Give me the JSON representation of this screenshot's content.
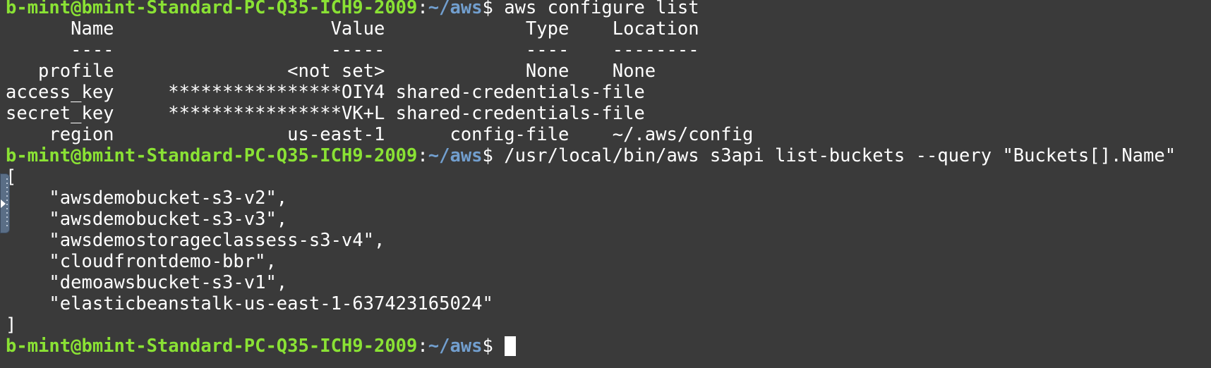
{
  "prompt": {
    "user_host": "b-mint@bmint-Standard-PC-Q35-ICH9-2009",
    "path": "~/aws",
    "sign": "$"
  },
  "commands": {
    "configure_list": "aws configure list",
    "list_buckets": "/usr/local/bin/aws s3api list-buckets --query \"Buckets[].Name\""
  },
  "configure_table": {
    "header": "      Name                    Value             Type    Location",
    "separator": "      ----                    -----             ----    --------",
    "rows": [
      "   profile                <not set>             None    None",
      "access_key     ****************OIY4 shared-credentials-file",
      "secret_key     ****************VK+L shared-credentials-file",
      "    region                us-east-1      config-file    ~/.aws/config"
    ]
  },
  "buckets_output": {
    "open_bracket": "[",
    "items": [
      "    \"awsdemobucket-s3-v2\",",
      "    \"awsdemobucket-s3-v3\",",
      "    \"awsdemostorageclassess-s3-v4\",",
      "    \"cloudfrontdemo-bbr\",",
      "    \"demoawsbucket-s3-v1\",",
      "    \"elasticbeanstalk-us-east-1-637423165024\""
    ],
    "close_bracket": "]"
  },
  "colors": {
    "background": "#3a3a3a",
    "prompt_user": "#8ae234",
    "prompt_path": "#729fcf",
    "text": "#ffffff"
  }
}
